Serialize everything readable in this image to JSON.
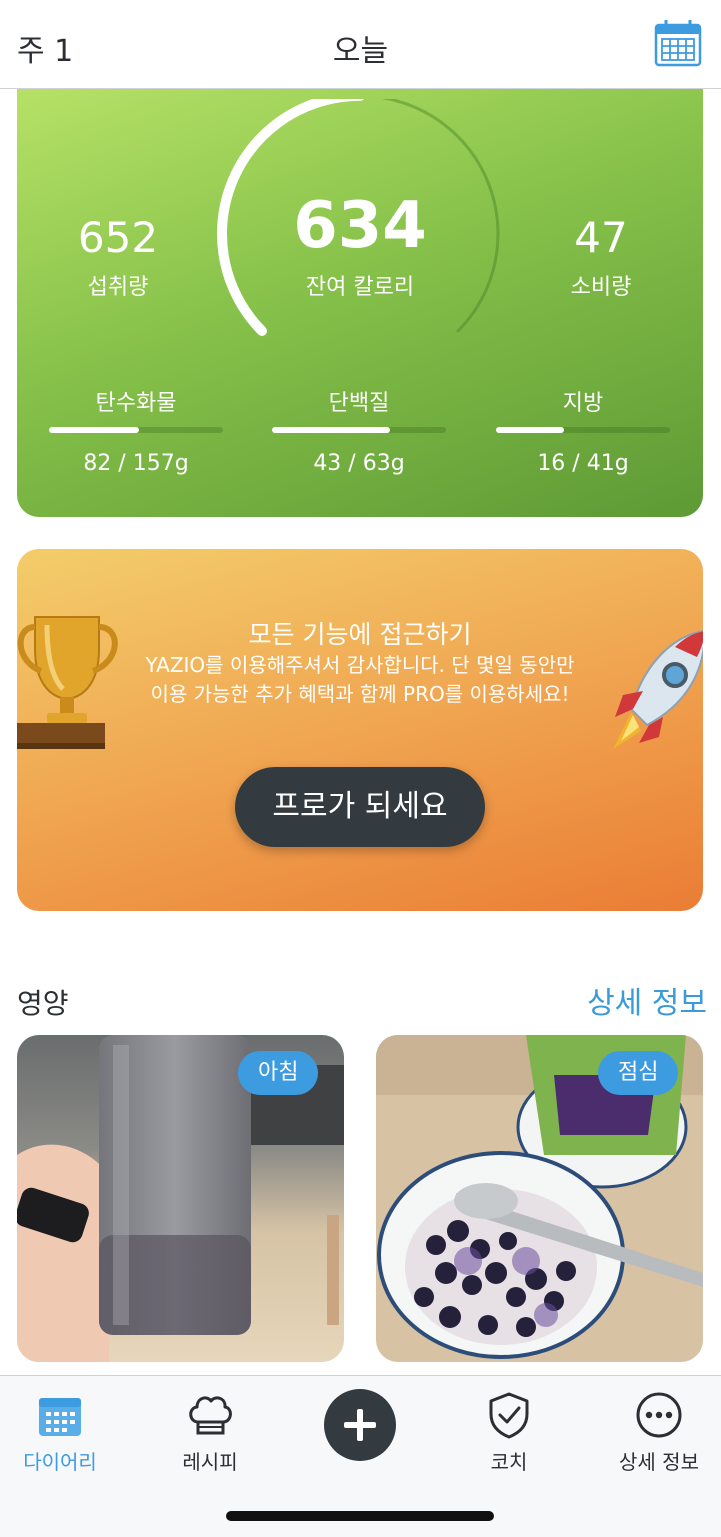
{
  "header": {
    "week_label": "주 1",
    "title": "오늘",
    "calendar_icon": "calendar-icon"
  },
  "calories": {
    "eaten_value": "652",
    "eaten_label": "섭취량",
    "remaining_value": "634",
    "remaining_label": "잔여 칼로리",
    "burned_value": "47",
    "burned_label": "소비량",
    "remaining_arc_fraction": 0.5
  },
  "macros": [
    {
      "label": "탄수화물",
      "value": "82 / 157g",
      "fraction": 0.52
    },
    {
      "label": "단백질",
      "value": "43 / 63g",
      "fraction": 0.68
    },
    {
      "label": "지방",
      "value": "16 / 41g",
      "fraction": 0.39
    }
  ],
  "promo": {
    "title": "모든 기능에 접근하기",
    "body": "YAZIO를 이용해주셔서 감사합니다. 단 몇일 동안만 이용 가능한 추가 혜택과 함께 PRO를 이용하세요!",
    "button": "프로가 되세요",
    "trophy_icon": "trophy-icon",
    "rocket_icon": "rocket-icon"
  },
  "nutrition": {
    "title": "영양",
    "more_link": "상세 정보",
    "meals": [
      {
        "tag": "아침"
      },
      {
        "tag": "점심"
      }
    ]
  },
  "tabbar": {
    "items": [
      {
        "label": "다이어리",
        "icon": "calendar-icon",
        "active": true
      },
      {
        "label": "레시피",
        "icon": "chef-hat-icon",
        "active": false
      },
      {
        "label": "",
        "icon": "plus-icon",
        "active": false
      },
      {
        "label": "코치",
        "icon": "shield-check-icon",
        "active": false
      },
      {
        "label": "상세 정보",
        "icon": "more-icon",
        "active": false
      }
    ]
  },
  "colors": {
    "accent": "#3d9be0",
    "green_card": "#86c14a",
    "orange_card": "#f0a551",
    "dark": "#343b40"
  }
}
